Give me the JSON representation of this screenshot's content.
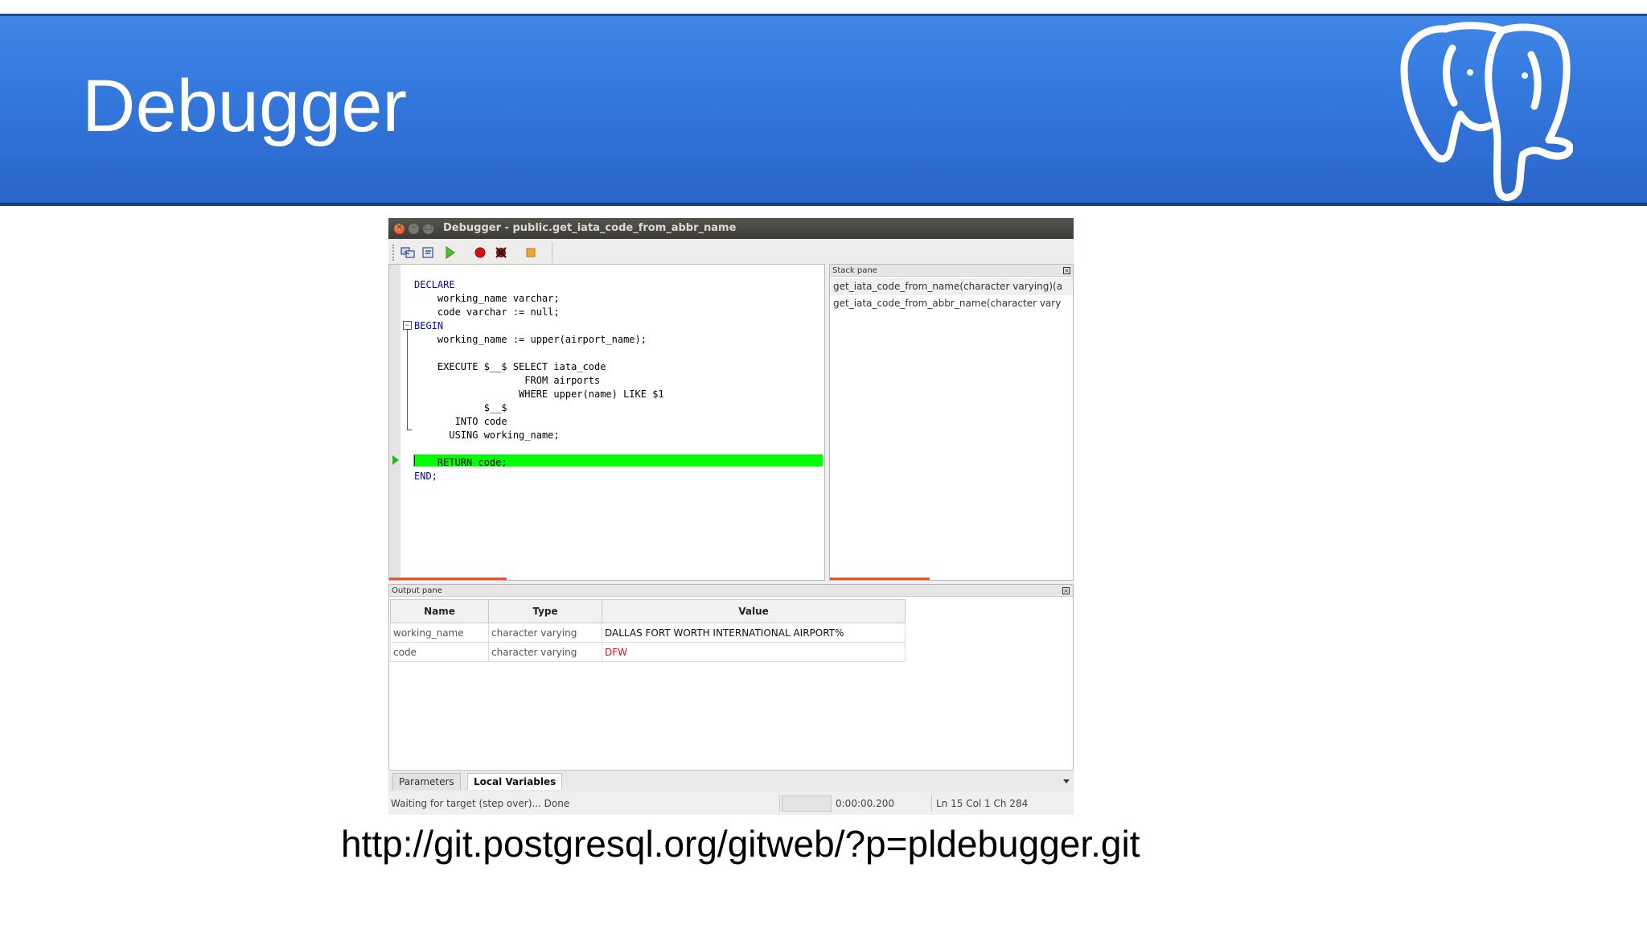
{
  "slide": {
    "title": "Debugger",
    "url": "http://git.postgresql.org/gitweb/?p=pldebugger.git",
    "header_color": "#3377dd"
  },
  "window": {
    "title": "Debugger - public.get_iata_code_from_abbr_name",
    "controls": {
      "close": "×",
      "minimize": "–",
      "maximize": "□"
    }
  },
  "toolbar": {
    "buttons": [
      "step-into-icon",
      "step-over-icon",
      "continue-icon",
      "set-breakpoint-icon",
      "clear-breakpoints-icon",
      "stop-icon"
    ]
  },
  "code": {
    "lines": [
      "DECLARE",
      "    working_name varchar;",
      "    code varchar := null;",
      "BEGIN",
      "    working_name := upper(airport_name);",
      "",
      "    EXECUTE $__$ SELECT iata_code",
      "                   FROM airports",
      "                  WHERE upper(name) LIKE $1",
      "            $__$",
      "       INTO code",
      "      USING working_name;",
      "",
      "    RETURN code;",
      "END;"
    ],
    "current_line": "    RETURN code;",
    "highlight_color": "#00ff00"
  },
  "stack_pane": {
    "header": "Stack pane",
    "frames": [
      "get_iata_code_from_name(character varying)(a",
      "get_iata_code_from_abbr_name(character vary"
    ]
  },
  "output_pane": {
    "header": "Output pane",
    "columns": [
      "Name",
      "Type",
      "Value"
    ],
    "rows": [
      {
        "name": "working_name",
        "type": "character varying",
        "value": "DALLAS FORT WORTH INTERNATIONAL AIRPORT%"
      },
      {
        "name": "code",
        "type": "character varying",
        "value": "DFW"
      }
    ],
    "tabs": [
      "Parameters",
      "Local Variables"
    ],
    "active_tab": "Local Variables"
  },
  "statusbar": {
    "message": "Waiting for target (step over)... Done",
    "elapsed": "0:00:00.200",
    "position": "Ln 15 Col 1 Ch 284"
  }
}
